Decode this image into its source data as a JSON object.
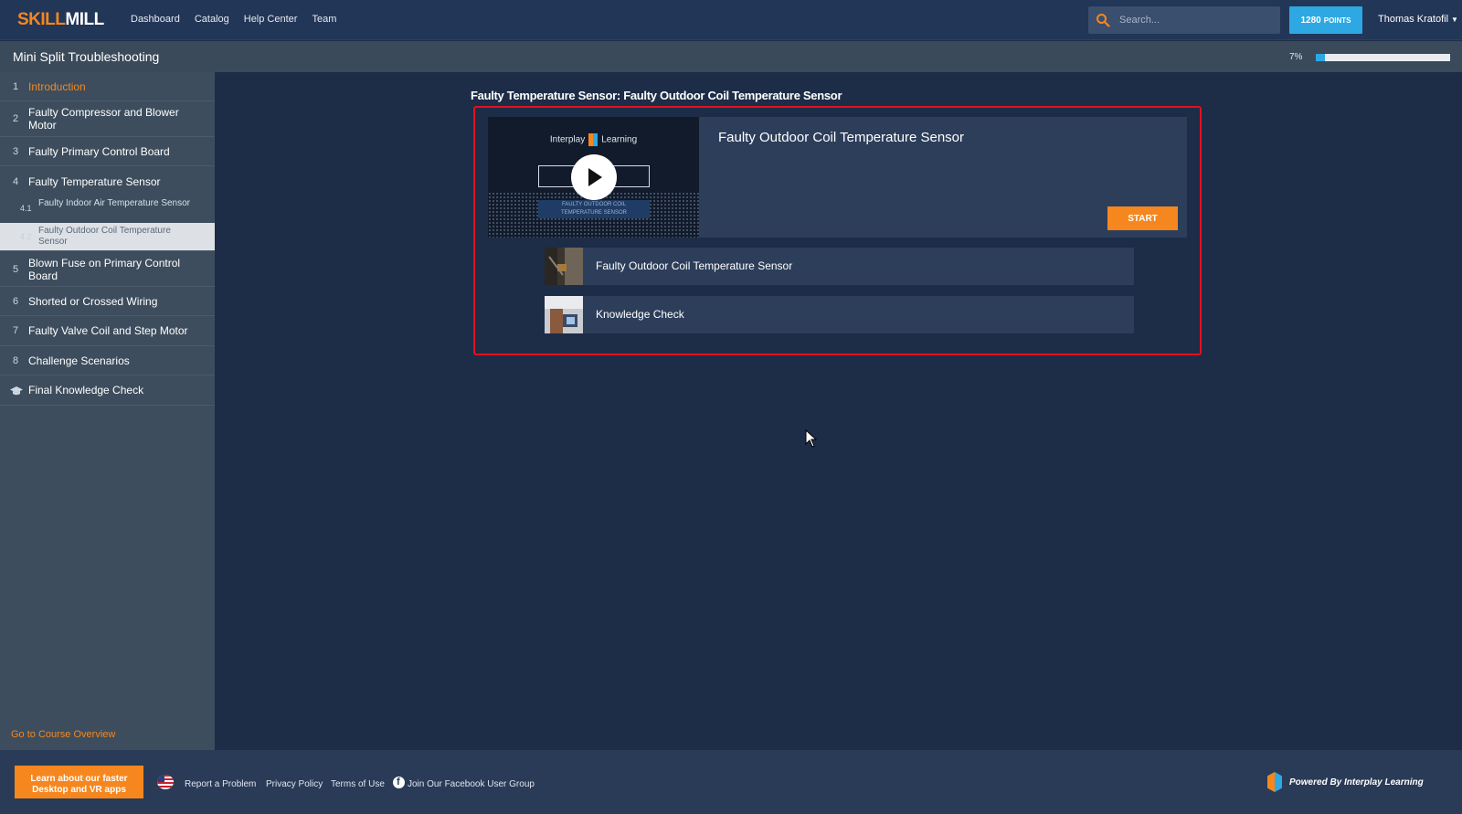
{
  "brand": {
    "logo_part1": "SKILL",
    "logo_part2": "MILL"
  },
  "nav": [
    "Dashboard",
    "Catalog",
    "Help Center",
    "Team"
  ],
  "search": {
    "placeholder": "Search..."
  },
  "points": {
    "value": "1280",
    "label": "POINTS"
  },
  "user": {
    "name": "Thomas Kratofil"
  },
  "course": {
    "title": "Mini Split Troubleshooting",
    "progress_label": "7%",
    "progress": 0.07
  },
  "sidebar": {
    "items": [
      {
        "num": "1",
        "label": "Introduction"
      },
      {
        "num": "2",
        "label": "Faulty Compressor and Blower Motor"
      },
      {
        "num": "3",
        "label": "Faulty Primary Control Board"
      },
      {
        "num": "4",
        "label": "Faulty Temperature Sensor"
      },
      {
        "num": "4.1",
        "label": "Faulty Indoor Air Temperature Sensor"
      },
      {
        "num": "4.2",
        "label": "Faulty Outdoor Coil Temperature Sensor"
      },
      {
        "num": "5",
        "label": "Blown Fuse on Primary Control Board"
      },
      {
        "num": "6",
        "label": "Shorted or Crossed Wiring"
      },
      {
        "num": "7",
        "label": "Faulty Valve Coil and Step Motor"
      },
      {
        "num": "8",
        "label": "Challenge Scenarios"
      },
      {
        "num": "",
        "label": "Final Knowledge Check",
        "icon": "graduation-cap-icon"
      }
    ],
    "overview_link": "Go to Course Overview"
  },
  "main": {
    "heading": "Faulty Temperature Sensor: Faulty Outdoor Coil Temperature Sensor",
    "card": {
      "title": "Faulty Outdoor Coil Temperature Sensor",
      "start_label": "START",
      "thumb_brand_left": "Interplay",
      "thumb_brand_right": "Learning",
      "thumb_frame_text": "TRO        ING",
      "thumb_caption_1": "FAULTY OUTDOOR COIL",
      "thumb_caption_2": "TEMPERATURE SENSOR"
    },
    "sub_items": [
      {
        "label": "Faulty Outdoor Coil Temperature Sensor"
      },
      {
        "label": "Knowledge Check"
      }
    ]
  },
  "footer": {
    "apps_line1": "Learn about our faster",
    "apps_line2": "Desktop and VR apps",
    "links": [
      "Report a Problem",
      "Privacy Policy",
      "Terms of Use",
      "Join Our Facebook User Group"
    ],
    "powered": "Powered By Interplay Learning"
  },
  "colors": {
    "accent_orange": "#f6871f",
    "accent_blue": "#2ea8e3",
    "highlight_red": "#e3101e",
    "bg": "#1d2c47"
  }
}
